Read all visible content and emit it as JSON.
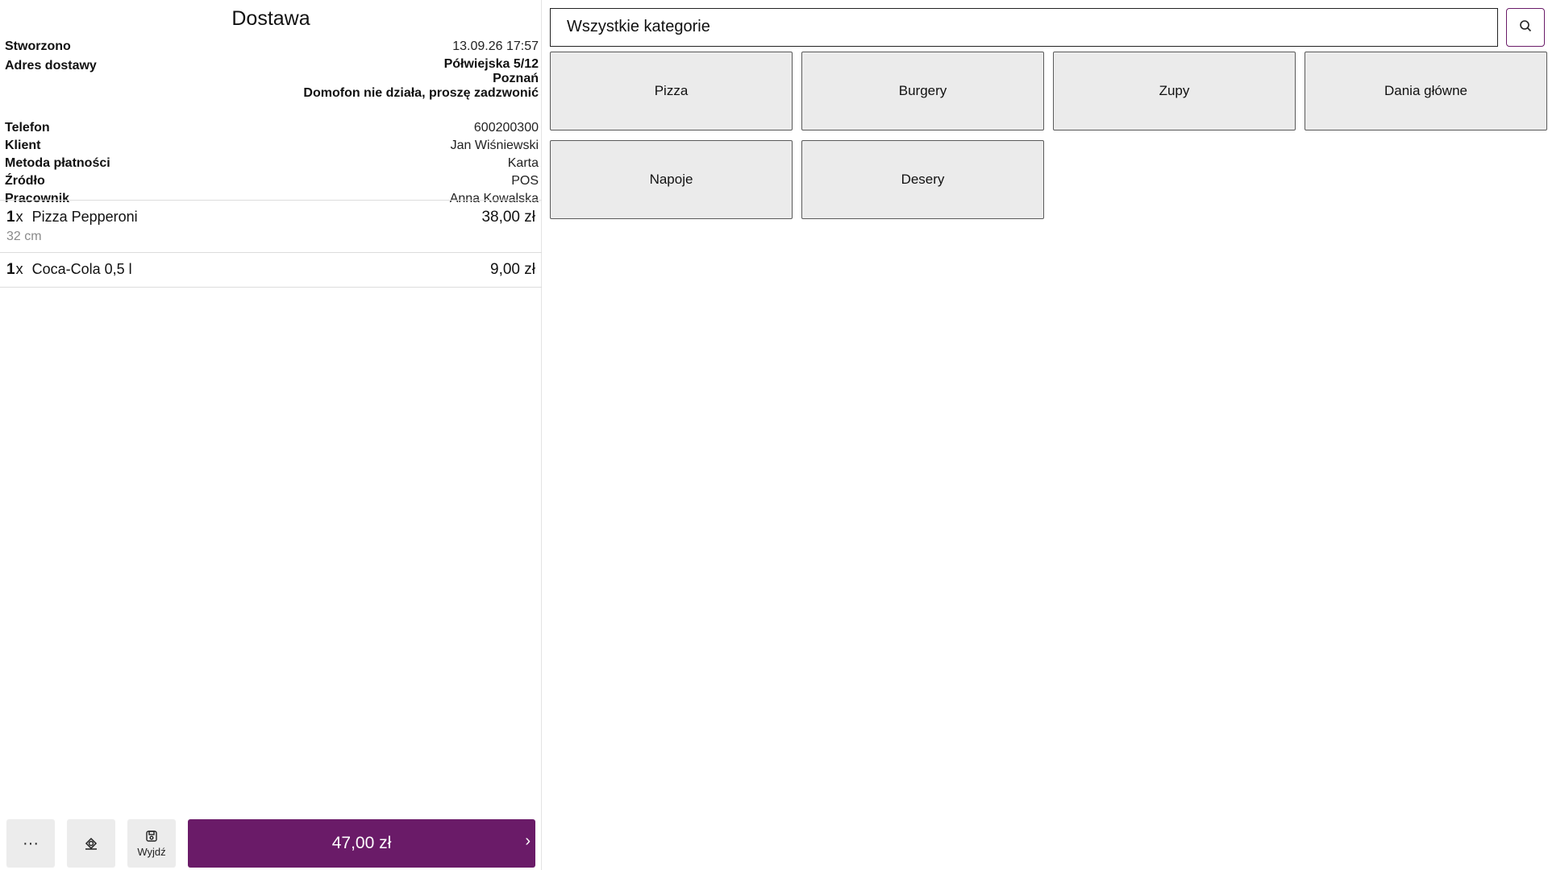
{
  "order": {
    "title": "Dostawa",
    "info": {
      "created_label": "Stworzono",
      "created_value": "13.09.26 17:57",
      "address_label": "Adres dostawy",
      "address_street": "Półwiejska 5/12",
      "address_city": "Poznań",
      "address_note": "Domofon nie działa, proszę zadzwonić",
      "phone_label": "Telefon",
      "phone_value": "600200300",
      "client_label": "Klient",
      "client_value": "Jan Wiśniewski",
      "payment_label": "Metoda płatności",
      "payment_value": "Karta",
      "source_label": "Źródło",
      "source_value": "POS",
      "employee_label": "Pracownik",
      "employee_value": "Anna Kowalska"
    },
    "lines": [
      {
        "qty": "1",
        "qty_suffix": "x",
        "name": "Pizza Pepperoni",
        "modifier": "32 cm",
        "price": "38,00 zł"
      },
      {
        "qty": "1",
        "qty_suffix": "x",
        "name": "Coca-Cola 0,5 l",
        "price": "9,00 zł"
      }
    ],
    "actions": {
      "more_glyph": "···",
      "exit_label": "Wyjdź",
      "total": "47,00 zł",
      "pay_chevron": "›"
    }
  },
  "search": {
    "category_value": "Wszystkie kategorie",
    "icon": "search-icon"
  },
  "categories": [
    "Pizza",
    "Burgery",
    "Zupy",
    "Dania główne",
    "Napoje",
    "Desery"
  ],
  "colors": {
    "accent": "#6a1b68",
    "tile_bg": "#ebebeb",
    "action_bg": "#ececec"
  }
}
